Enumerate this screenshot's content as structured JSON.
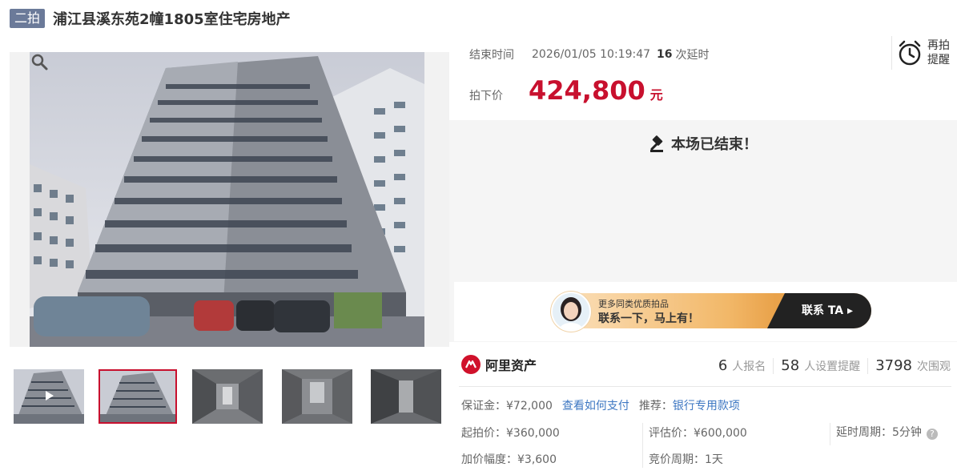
{
  "header": {
    "tag": "二拍",
    "title": "浦江县溪东苑2幢1805室住宅房地产"
  },
  "auction": {
    "end_time_label": "结束时间",
    "end_time": "2026/01/05 10:19:47",
    "delay_count": "16",
    "delay_label": "次延时",
    "remind_label": "再拍提醒",
    "price_label": "拍下价",
    "price": "424,800",
    "price_unit": "元",
    "ended_message": "本场已结束！"
  },
  "banner": {
    "line1": "更多同类优质拍品",
    "line2": "联系一下，马上有！",
    "contact": "联系 TA ▸"
  },
  "brand": {
    "name": "阿里资产"
  },
  "stats": {
    "signups": "6",
    "signups_label": "人报名",
    "reminders": "58",
    "reminders_label": "人设置提醒",
    "views": "3798",
    "views_label": "次围观"
  },
  "details": {
    "deposit": "保证金：¥72,000",
    "pay_link": "查看如何支付",
    "recommend_label": "推荐：",
    "recommend_link": "银行专用款项",
    "start_price": "起拍价：¥360,000",
    "appraised": "评估价：¥600,000",
    "delay_period": "延时周期：5分钟",
    "increment": "加价幅度：¥3,600",
    "bid_period": "竞价周期：1天"
  },
  "colors": {
    "accent_red": "#c8102e",
    "link_blue": "#3d77c2",
    "tag_bg": "#6b7a99"
  }
}
